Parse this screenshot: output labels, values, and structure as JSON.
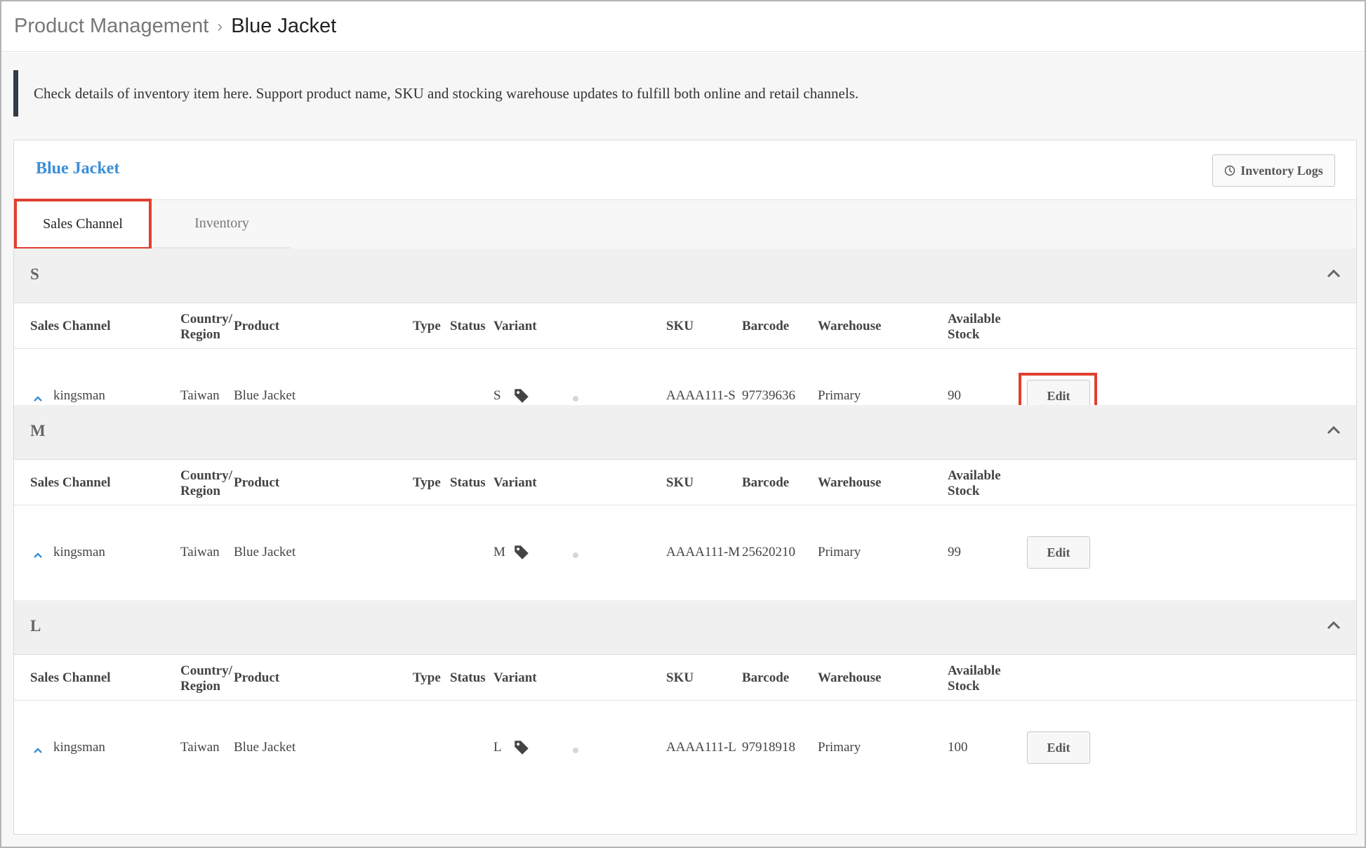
{
  "breadcrumb": {
    "root": "Product Management",
    "current": "Blue Jacket"
  },
  "notice": "Check details of inventory item here. Support product name, SKU and stocking warehouse updates to fulfill both online and retail channels.",
  "card": {
    "title": "Blue Jacket",
    "logs_button": "Inventory Logs",
    "logs_icon": "clock-icon"
  },
  "tabs": [
    {
      "label": "Sales Channel",
      "active": true
    },
    {
      "label": "Inventory",
      "active": false
    }
  ],
  "columns": {
    "sales_channel": "Sales Channel",
    "country_line1": "Country/",
    "country_line2": "Region",
    "product": "Product",
    "type": "Type",
    "status": "Status",
    "variant": "Variant",
    "sku": "SKU",
    "barcode": "Barcode",
    "warehouse": "Warehouse",
    "stock_line1": "Available",
    "stock_line2": "Stock"
  },
  "groups": [
    {
      "label": "S",
      "rows": [
        {
          "channel": "kingsman",
          "country": "Taiwan",
          "product": "Blue Jacket",
          "type_icon": "tag-icon",
          "variant": "S",
          "sku": "AAAA111-S",
          "barcode": "97739636",
          "warehouse": "Primary",
          "stock": "90",
          "edit": "Edit"
        }
      ]
    },
    {
      "label": "M",
      "rows": [
        {
          "channel": "kingsman",
          "country": "Taiwan",
          "product": "Blue Jacket",
          "type_icon": "tag-icon",
          "variant": "M",
          "sku": "AAAA111-M",
          "barcode": "25620210",
          "warehouse": "Primary",
          "stock": "99",
          "edit": "Edit"
        }
      ]
    },
    {
      "label": "L",
      "rows": [
        {
          "channel": "kingsman",
          "country": "Taiwan",
          "product": "Blue Jacket",
          "type_icon": "tag-icon",
          "variant": "L",
          "sku": "AAAA111-L",
          "barcode": "97918918",
          "warehouse": "Primary",
          "stock": "100",
          "edit": "Edit"
        }
      ]
    }
  ],
  "colors": {
    "accent": "#3b8ed8",
    "highlight": "#e0402f",
    "notice_border": "#323c46"
  }
}
